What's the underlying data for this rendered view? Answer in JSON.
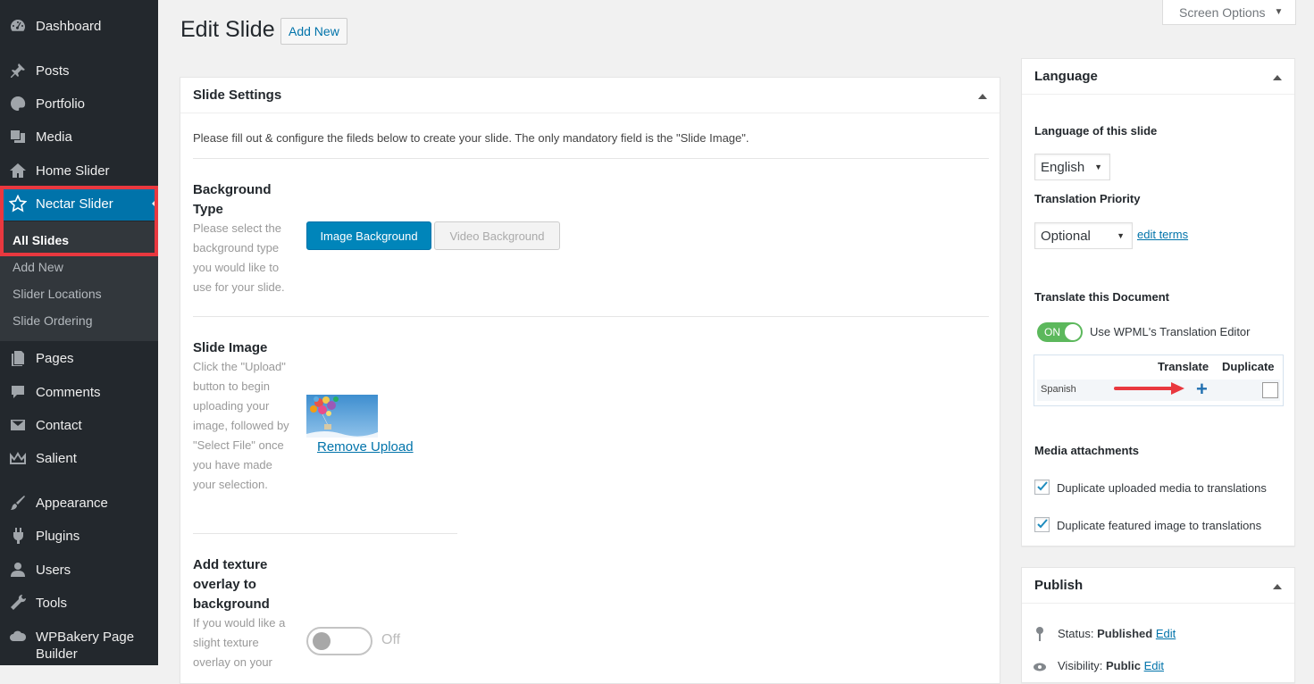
{
  "sidebar": {
    "items": [
      {
        "label": "Dashboard",
        "icon": "dashboard-icon"
      },
      {
        "label": "Posts",
        "icon": "pin-icon"
      },
      {
        "label": "Portfolio",
        "icon": "palette-icon"
      },
      {
        "label": "Media",
        "icon": "media-icon"
      },
      {
        "label": "Home Slider",
        "icon": "home-icon"
      },
      {
        "label": "Nectar Slider",
        "icon": "star-icon"
      },
      {
        "label": "Pages",
        "icon": "page-icon"
      },
      {
        "label": "Comments",
        "icon": "comment-icon"
      },
      {
        "label": "Contact",
        "icon": "mail-icon"
      },
      {
        "label": "Salient",
        "icon": "crown-icon"
      },
      {
        "label": "Appearance",
        "icon": "brush-icon"
      },
      {
        "label": "Plugins",
        "icon": "plug-icon"
      },
      {
        "label": "Users",
        "icon": "user-icon"
      },
      {
        "label": "Tools",
        "icon": "wrench-icon"
      },
      {
        "label": "WPBakery Page Builder",
        "icon": "cloud-icon"
      }
    ],
    "submenu": [
      "All Slides",
      "Add New",
      "Slider Locations",
      "Slide Ordering"
    ],
    "accent_color": "#0073aa",
    "highlight_color": "#e9383f"
  },
  "header": {
    "title": "Edit Slide",
    "add_new": "Add New",
    "screen_options": "Screen Options"
  },
  "slide_settings": {
    "title": "Slide Settings",
    "intro": "Please fill out & configure the fileds below to create your slide. The only mandatory field is the \"Slide Image\".",
    "background_type": {
      "label": "Background Type",
      "description": "Please select the background type you would like to use for your slide.",
      "image_button": "Image Background",
      "video_button": "Video Background"
    },
    "slide_image": {
      "label": "Slide Image",
      "description": "Click the \"Upload\" button to begin uploading your image, followed by \"Select File\" once you have made your selection.",
      "remove": "Remove Upload"
    },
    "texture": {
      "label": "Add texture overlay to background",
      "description": "If you would like a slight texture overlay on your",
      "state": "Off"
    }
  },
  "language": {
    "title": "Language",
    "lang_label": "Language of this slide",
    "lang_value": "English",
    "priority_label": "Translation Priority",
    "priority_value": "Optional",
    "edit_terms": "edit terms",
    "translate_doc_label": "Translate this Document",
    "toggle_state": "ON",
    "toggle_caption": "Use WPML's Translation Editor",
    "table_translate": "Translate",
    "table_duplicate": "Duplicate",
    "table_lang": "Spanish",
    "media_label": "Media attachments",
    "dup_media": "Duplicate uploaded media to translations",
    "dup_featured": "Duplicate featured image to translations"
  },
  "publish": {
    "title": "Publish",
    "status_label": "Status:",
    "status_value": "Published",
    "status_edit": "Edit",
    "visibility_label": "Visibility:",
    "visibility_value": "Public",
    "visibility_edit": "Edit"
  }
}
